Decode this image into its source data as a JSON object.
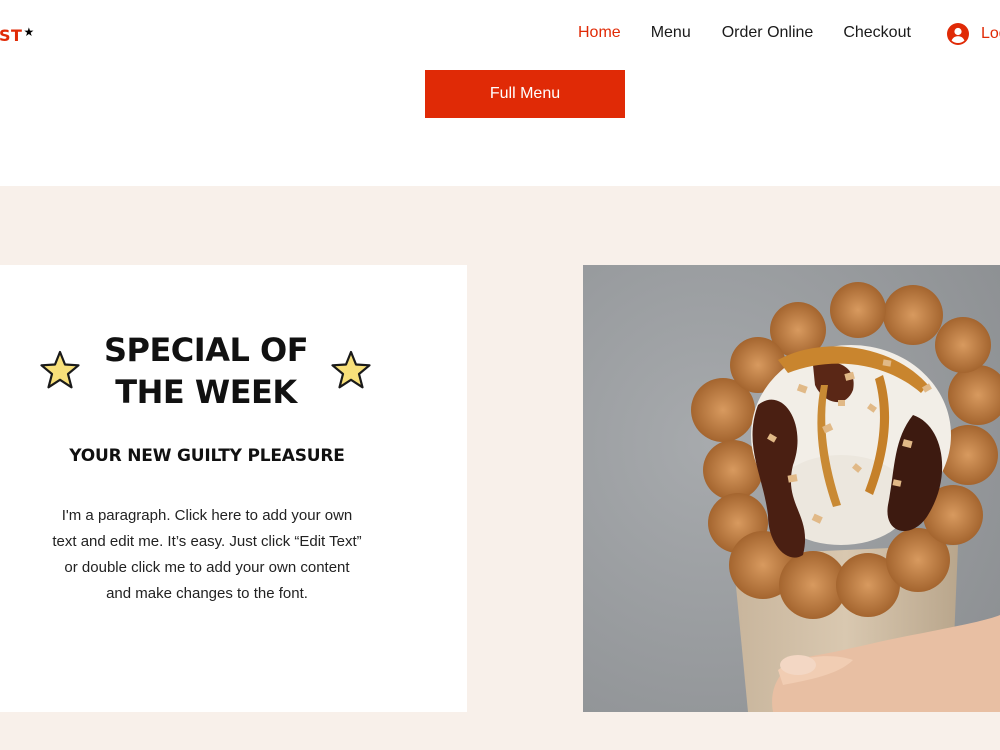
{
  "header": {
    "logo_text": "ST",
    "logo_star": "★",
    "nav": [
      {
        "label": "Home"
      },
      {
        "label": "Menu"
      },
      {
        "label": "Order Online"
      },
      {
        "label": "Checkout"
      }
    ],
    "login_label": "Log"
  },
  "hero": {
    "full_menu_label": "Full Menu"
  },
  "special": {
    "title_line1": "SPECIAL OF",
    "title_line2": "THE WEEK",
    "subtitle": "YOUR NEW GUILTY PLEASURE",
    "paragraph": "I'm a paragraph. Click here to add your own text and edit me. It’s easy. Just click “Edit Text” or double click me to add your own content and make changes to the font.",
    "image_alt": "bubble waffle ice cream sundae with chocolate, caramel and nuts"
  },
  "colors": {
    "accent": "#e02a06",
    "section_bg": "#f8f0ea",
    "star_fill": "#f8e07a"
  },
  "icons": {
    "user": "user-circle-icon",
    "star": "star-icon"
  }
}
